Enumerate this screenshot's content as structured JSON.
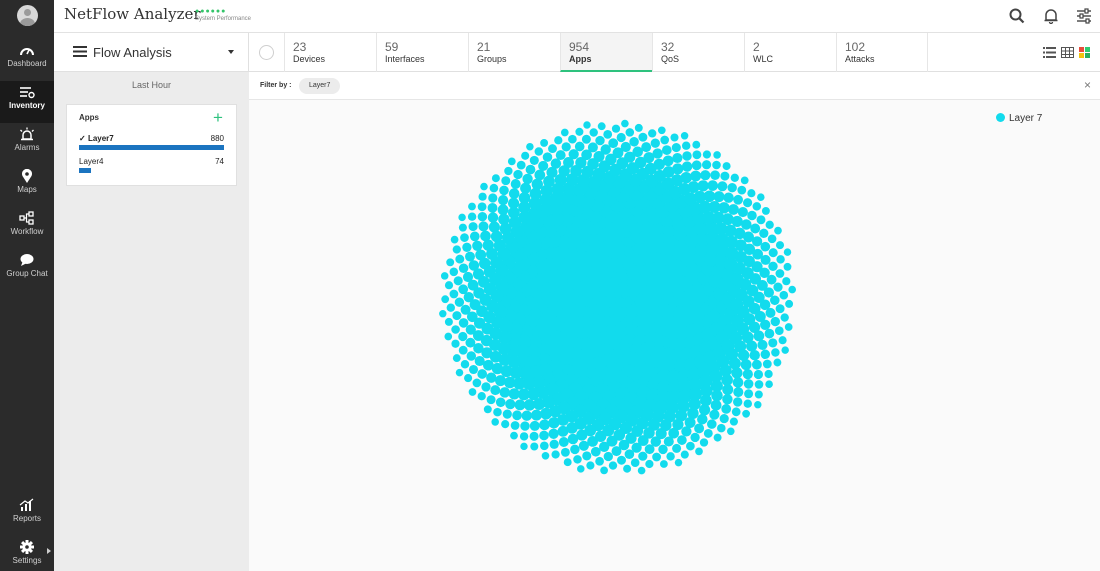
{
  "app": {
    "title": "NetFlow Analyzer",
    "perf_dots": "●●●●●●",
    "perf_label": "System Performance"
  },
  "nav": {
    "items": [
      {
        "label": "Dashboard",
        "icon": "gauge-icon"
      },
      {
        "label": "Inventory",
        "icon": "inventory-icon",
        "active": true
      },
      {
        "label": "Alarms",
        "icon": "alarm-icon"
      },
      {
        "label": "Maps",
        "icon": "map-pin-icon"
      },
      {
        "label": "Workflow",
        "icon": "workflow-icon"
      },
      {
        "label": "Group Chat",
        "icon": "chat-bubble-icon"
      },
      {
        "label": "Reports",
        "icon": "bar-chart-icon"
      },
      {
        "label": "Settings",
        "icon": "gear-icon"
      }
    ]
  },
  "flow": {
    "label": "Flow Analysis"
  },
  "tabs": [
    {
      "count": "23",
      "label": "Devices"
    },
    {
      "count": "59",
      "label": "Interfaces"
    },
    {
      "count": "21",
      "label": "Groups"
    },
    {
      "count": "954",
      "label": "Apps",
      "active": true
    },
    {
      "count": "32",
      "label": "QoS"
    },
    {
      "count": "2",
      "label": "WLC"
    },
    {
      "count": "102",
      "label": "Attacks"
    }
  ],
  "side": {
    "time_label": "Last Hour",
    "apps_title": "Apps",
    "add_symbol": "+",
    "rows": [
      {
        "name": "Layer7",
        "count": "880",
        "check": "✓",
        "fraction": 1.0,
        "selected": true
      },
      {
        "name": "Layer4",
        "count": "74",
        "check": "",
        "fraction": 0.084,
        "selected": false
      }
    ]
  },
  "filter": {
    "label": "Filter by :",
    "chip": "Layer7",
    "close": "×"
  },
  "legend": {
    "label": "Layer 7",
    "color": "#12dbed"
  },
  "colors": {
    "accent": "#2ec27e",
    "bar": "#1b74c0",
    "bubble": "#12dbed"
  }
}
